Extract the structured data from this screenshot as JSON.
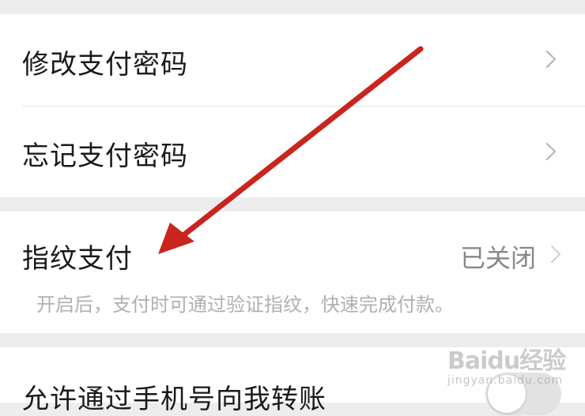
{
  "settings": {
    "change_password": {
      "label": "修改支付密码",
      "icon": "chevron-right-icon"
    },
    "forgot_password": {
      "label": "忘记支付密码",
      "icon": "chevron-right-icon"
    },
    "fingerprint": {
      "label": "指纹支付",
      "status": "已关闭",
      "description": "开启后，支付时可通过验证指纹，快速完成付款。",
      "icon": "chevron-right-icon"
    },
    "phone_transfer": {
      "label": "允许通过手机号向我转账",
      "enabled": false
    }
  },
  "annotation": {
    "color": "#c8251e",
    "icon": "red-arrow-icon"
  },
  "watermark": {
    "brand": "Baidu经验",
    "url": "jingyan.baidu.com"
  }
}
